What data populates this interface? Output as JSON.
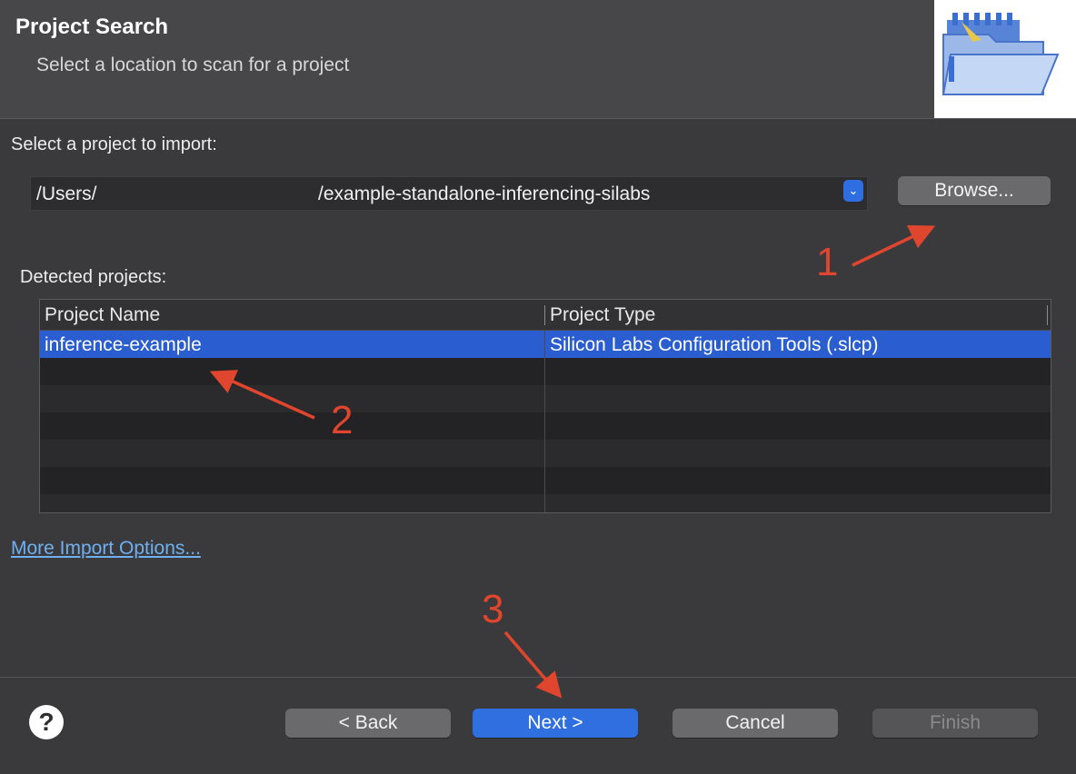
{
  "header": {
    "title": "Project Search",
    "subtitle": "Select a location to scan for a project",
    "image_icon": "folder-wizard-icon"
  },
  "import": {
    "label": "Select a project to import:",
    "path_prefix": "/Users/",
    "path_suffix": "/example-standalone-inferencing-silabs",
    "browse_label": "Browse..."
  },
  "projects": {
    "label": "Detected projects:",
    "columns": [
      "Project Name",
      "Project Type"
    ],
    "rows": [
      {
        "name": "inference-example",
        "type": "Silicon Labs Configuration Tools (.slcp)"
      }
    ]
  },
  "more_options_link": "More Import Options...",
  "buttons": {
    "back": "< Back",
    "next": "Next >",
    "cancel": "Cancel",
    "finish": "Finish",
    "help": "?"
  },
  "annotations": [
    "1",
    "2",
    "3"
  ],
  "colors": {
    "accent": "#2f6fe0",
    "annotation": "#e0452e",
    "selection": "#2a5ed0"
  }
}
